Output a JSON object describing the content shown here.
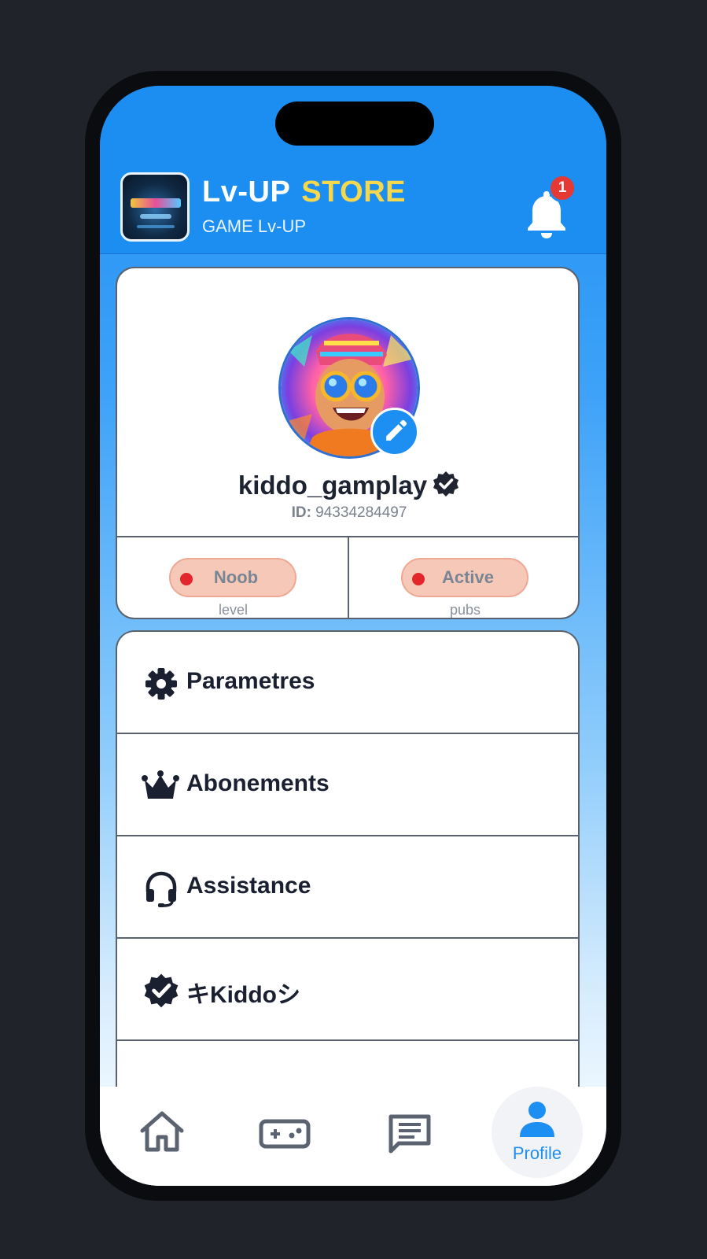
{
  "header": {
    "title_part1": "Lv-UP",
    "title_part2": "STORE",
    "subtitle": "GAME Lv-UP",
    "notification_count": "1"
  },
  "profile": {
    "username": "kiddo_gamplay",
    "id_label": "ID:",
    "id_value": "94334284497",
    "stats": [
      {
        "value": "Noob",
        "label": "level"
      },
      {
        "value": "Active",
        "label": "pubs"
      }
    ]
  },
  "menu": {
    "items": [
      {
        "label": "Parametres",
        "icon": "gear-icon"
      },
      {
        "label": "Abonements",
        "icon": "crown-icon"
      },
      {
        "label": "Assistance",
        "icon": "headset-icon"
      },
      {
        "label": "キKiddoシ",
        "icon": "verified-icon"
      }
    ]
  },
  "nav": {
    "items": [
      {
        "icon": "home-icon"
      },
      {
        "icon": "gamepad-icon"
      },
      {
        "icon": "chat-icon"
      },
      {
        "icon": "profile-icon",
        "label": "Profile",
        "active": true
      }
    ]
  },
  "colors": {
    "primary": "#1e8ff2",
    "accent_yellow": "#f5d84d",
    "badge_red": "#e53935",
    "pill_bg": "#f5c8b7",
    "status_dot": "#e3262b"
  }
}
